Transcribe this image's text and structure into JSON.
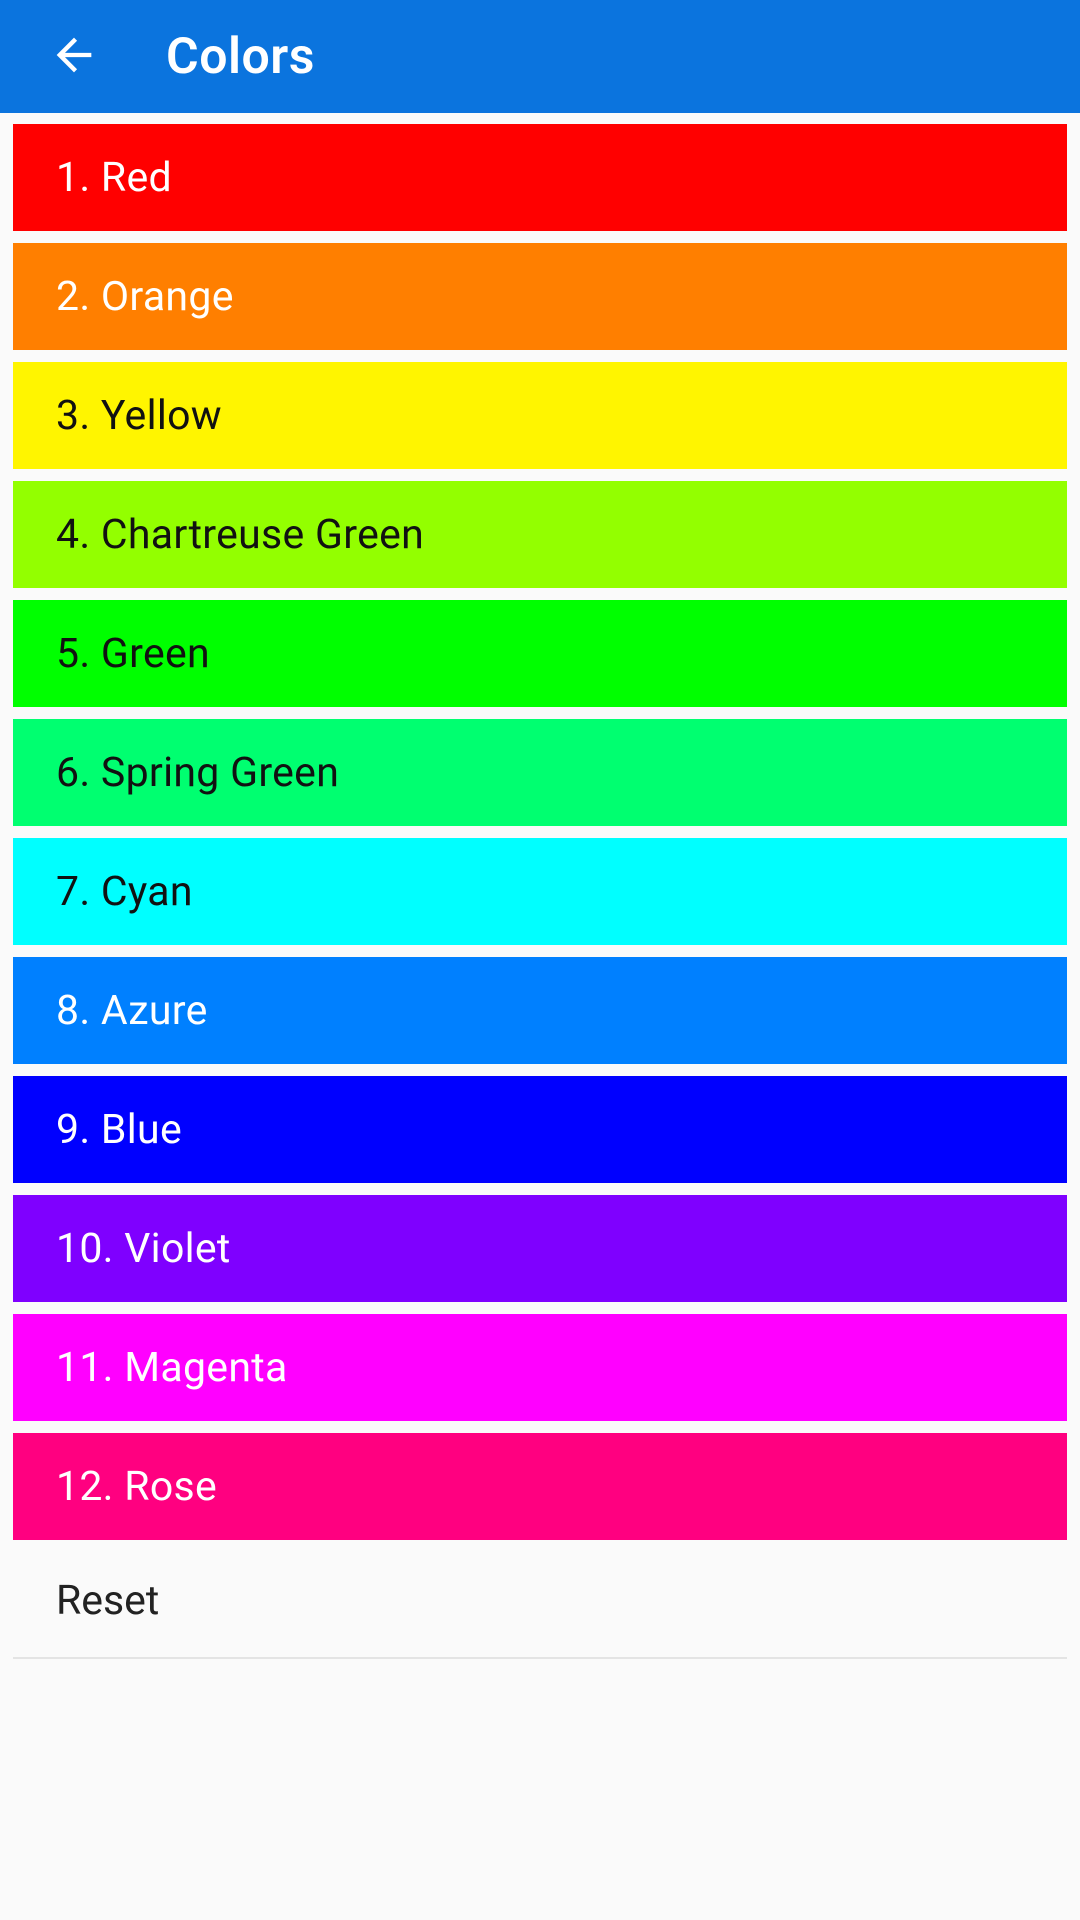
{
  "appbar": {
    "title": "Colors",
    "back_icon": "arrow-left-icon",
    "background": "#0b74de"
  },
  "colors": [
    {
      "label": "1. Red",
      "bg": "#ff0000",
      "fg": "#ffffff"
    },
    {
      "label": "2. Orange",
      "bg": "#ff7f00",
      "fg": "#ffffff"
    },
    {
      "label": "3. Yellow",
      "bg": "#fff500",
      "fg": "#111111"
    },
    {
      "label": "4. Chartreuse Green",
      "bg": "#93ff00",
      "fg": "#111111"
    },
    {
      "label": "5. Green",
      "bg": "#00ff00",
      "fg": "#111111"
    },
    {
      "label": "6. Spring Green",
      "bg": "#00ff70",
      "fg": "#111111"
    },
    {
      "label": "7. Cyan",
      "bg": "#00ffff",
      "fg": "#111111"
    },
    {
      "label": "8. Azure",
      "bg": "#0080ff",
      "fg": "#ffffff"
    },
    {
      "label": "9. Blue",
      "bg": "#0000ff",
      "fg": "#ffffff"
    },
    {
      "label": "10. Violet",
      "bg": "#7f00ff",
      "fg": "#ffffff"
    },
    {
      "label": "11. Magenta",
      "bg": "#ff00ff",
      "fg": "#ffffff"
    },
    {
      "label": "12. Rose",
      "bg": "#ff0080",
      "fg": "#ffffff"
    }
  ],
  "reset": {
    "label": "Reset"
  }
}
